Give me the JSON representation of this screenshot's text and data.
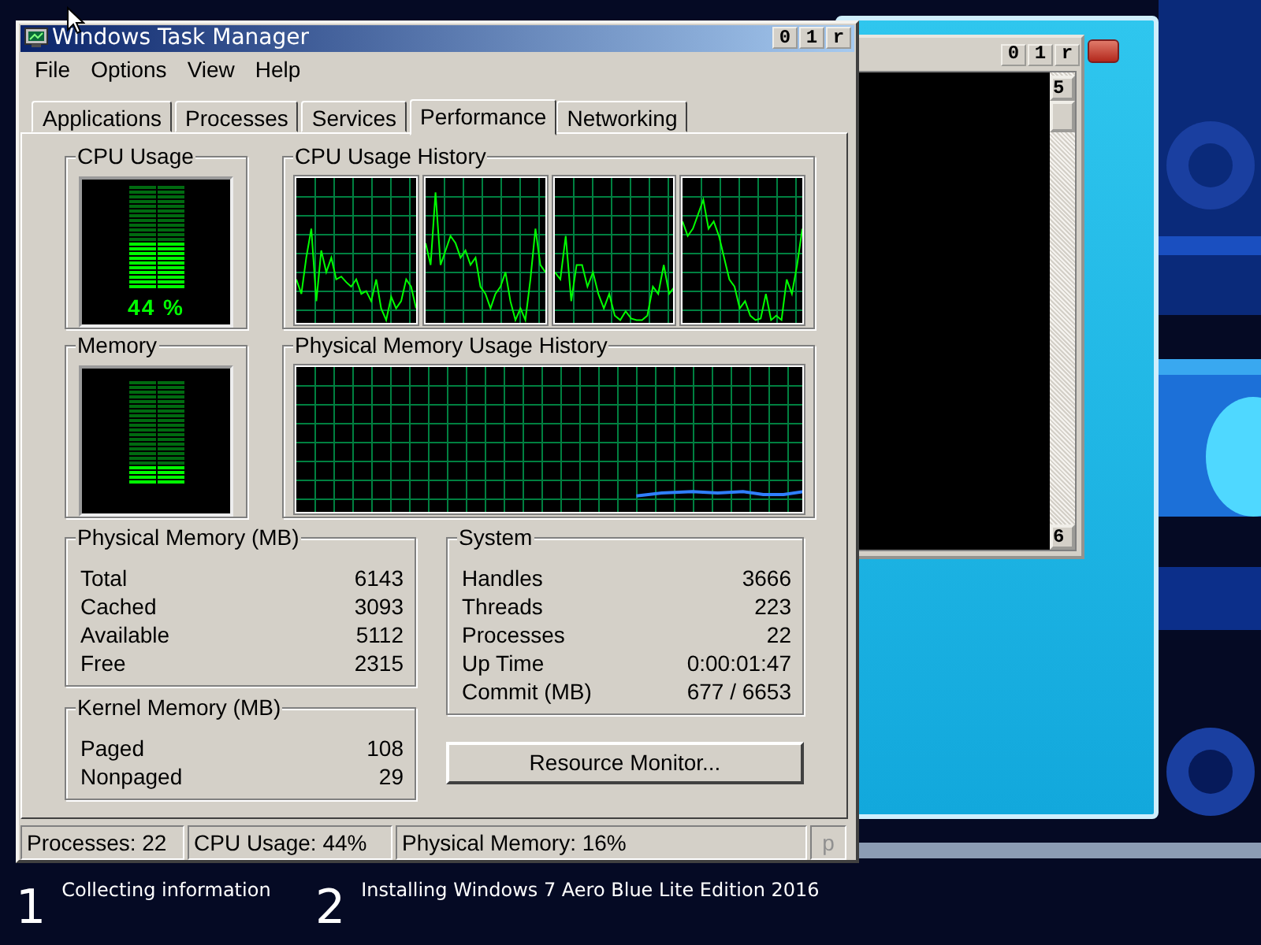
{
  "task_manager": {
    "title": "Windows Task Manager",
    "title_buttons": [
      "0",
      "1",
      "r"
    ],
    "menu": [
      "File",
      "Options",
      "View",
      "Help"
    ],
    "tabs": [
      {
        "label": "Applications",
        "selected": false
      },
      {
        "label": "Processes",
        "selected": false
      },
      {
        "label": "Services",
        "selected": false
      },
      {
        "label": "Performance",
        "selected": true
      },
      {
        "label": "Networking",
        "selected": false
      }
    ],
    "cpu_usage": {
      "title": "CPU Usage",
      "level": 0.44,
      "reading": "44 %"
    },
    "cpu_history": {
      "title": "CPU Usage History"
    },
    "memory": {
      "title": "Memory",
      "level": 0.16
    },
    "memory_history": {
      "title": "Physical Memory Usage History"
    },
    "physical_memory": {
      "title": "Physical Memory (MB)",
      "rows": [
        {
          "label": "Total",
          "value": "6143"
        },
        {
          "label": "Cached",
          "value": "3093"
        },
        {
          "label": "Available",
          "value": "5112"
        },
        {
          "label": "Free",
          "value": "2315"
        }
      ]
    },
    "kernel_memory": {
      "title": "Kernel Memory (MB)",
      "rows": [
        {
          "label": "Paged",
          "value": "108"
        },
        {
          "label": "Nonpaged",
          "value": "29"
        }
      ]
    },
    "system": {
      "title": "System",
      "rows": [
        {
          "label": "Handles",
          "value": "3666"
        },
        {
          "label": "Threads",
          "value": "223"
        },
        {
          "label": "Processes",
          "value": "22"
        },
        {
          "label": "Up Time",
          "value": "0:00:01:47"
        },
        {
          "label": "Commit (MB)",
          "value": "677 / 6653"
        }
      ]
    },
    "resource_monitor_button": "Resource Monitor...",
    "status_bar": [
      "Processes: 22",
      "CPU Usage: 44%",
      "Physical Memory: 16%",
      "p"
    ]
  },
  "console_window": {
    "title_buttons": [
      "0",
      "1",
      "r"
    ],
    "scroll_up": "5",
    "scroll_down": "6"
  },
  "setup_steps": [
    {
      "number": "1",
      "label": "Collecting information"
    },
    {
      "number": "2",
      "label": "Installing Windows 7 Aero Blue Lite Edition 2016"
    }
  ]
}
